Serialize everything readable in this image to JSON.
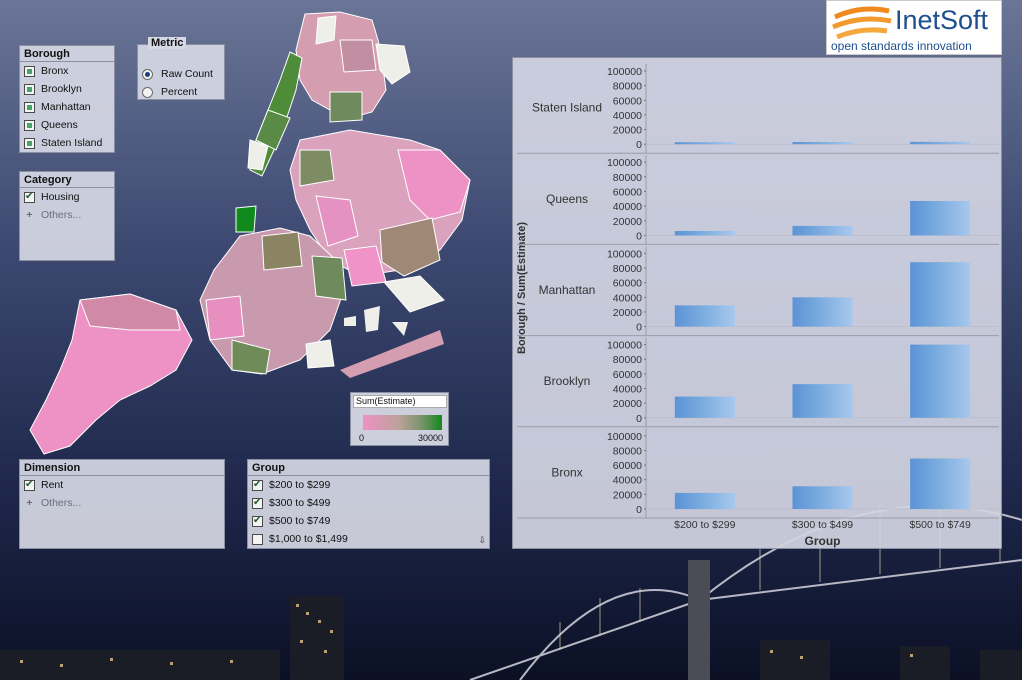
{
  "logo": {
    "name": "InetSoft",
    "tagline": "open standards innovation"
  },
  "borough_filter": {
    "title": "Borough",
    "items": [
      "Bronx",
      "Brooklyn",
      "Manhattan",
      "Queens",
      "Staten Island"
    ]
  },
  "metric": {
    "title": "Metric",
    "options": [
      {
        "label": "Raw Count",
        "selected": true
      },
      {
        "label": "Percent",
        "selected": false
      }
    ]
  },
  "category_filter": {
    "title": "Category",
    "items": [
      {
        "label": "Housing",
        "checked": true
      }
    ],
    "others_label": "Others..."
  },
  "dimension_filter": {
    "title": "Dimension",
    "items": [
      {
        "label": "Rent",
        "checked": true
      }
    ],
    "others_label": "Others..."
  },
  "group_filter": {
    "title": "Group",
    "items": [
      {
        "label": "$200 to $299",
        "checked": true
      },
      {
        "label": "$300 to $499",
        "checked": true
      },
      {
        "label": "$500 to $749",
        "checked": true
      },
      {
        "label": "$1,000 to $1,499",
        "checked": false
      }
    ]
  },
  "map_legend": {
    "title": "Sum(Estimate)",
    "min": "0",
    "max": "30000",
    "colors": [
      "#ee91c5",
      "#bda39a",
      "#76936a",
      "#0f8a1a"
    ]
  },
  "chart_data": {
    "type": "bar",
    "xlabel": "Group",
    "ylabel": "Borough / Sum(Estimate)",
    "categories": [
      "$200 to $299",
      "$300 to $499",
      "$500 to $749"
    ],
    "yticks": [
      "0",
      "20000",
      "40000",
      "60000",
      "80000",
      "100000"
    ],
    "ylim": [
      0,
      100000
    ],
    "bar_color": "#7eaee0",
    "series": [
      {
        "name": "Staten Island",
        "values": [
          1200,
          3000,
          3200
        ]
      },
      {
        "name": "Queens",
        "values": [
          6000,
          13000,
          47000
        ]
      },
      {
        "name": "Manhattan",
        "values": [
          29000,
          40000,
          88000
        ]
      },
      {
        "name": "Brooklyn",
        "values": [
          29000,
          46000,
          100000
        ]
      },
      {
        "name": "Bronx",
        "values": [
          22000,
          31000,
          69000
        ]
      }
    ]
  }
}
